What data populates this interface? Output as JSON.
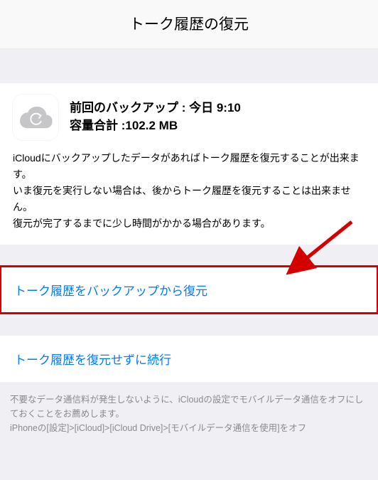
{
  "header": {
    "title": "トーク履歴の復元"
  },
  "backup": {
    "lastBackupLabel": "前回のバックアップ : ",
    "lastBackupValue": "今日 9:10",
    "totalSizeLabel": "容量合計 :",
    "totalSizeValue": "102.2 MB",
    "description": "iCloudにバックアップしたデータがあればトーク履歴を復元することが出来ます。\nいま復元を実行しない場合は、後からトーク履歴を復元することは出来ません。\n復元が完了するまでに少し時間がかかる場合があります。"
  },
  "options": {
    "restore": "トーク履歴をバックアップから復元",
    "continueWithoutRestore": "トーク履歴を復元せずに続行"
  },
  "footerNote": "不要なデータ通信料が発生しないように、iCloudの設定でモバイルデータ通信をオフにしておくことをお薦めします。\niPhoneの[設定]>[iCloud]>[iCloud Drive]>[モバイルデータ通信を使用]をオフ"
}
